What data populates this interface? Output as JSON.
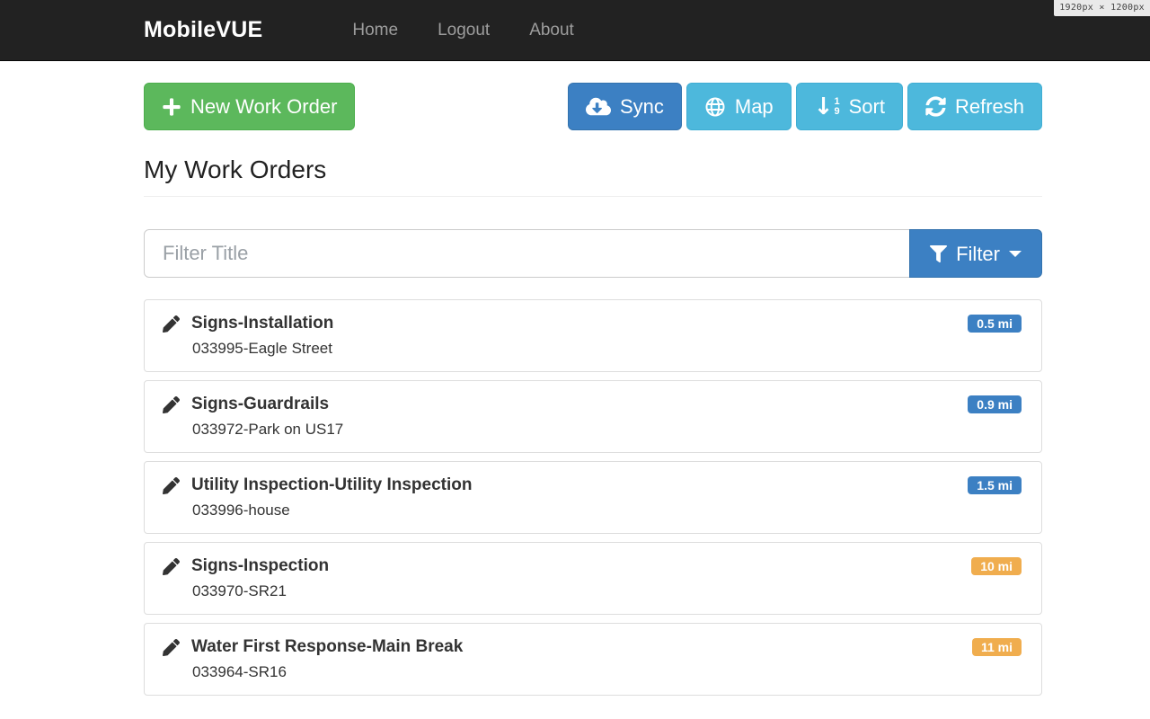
{
  "devtools_overlay": {
    "dimensions": "1920px × 1200px"
  },
  "navbar": {
    "brand": "MobileVUE",
    "links": [
      {
        "label": "Home"
      },
      {
        "label": "Logout"
      },
      {
        "label": "About"
      }
    ]
  },
  "toolbar": {
    "new_work_order_label": "New Work Order",
    "sync_label": "Sync",
    "map_label": "Map",
    "sort_label": "Sort",
    "sort_icon_top_digit": "1",
    "sort_icon_bottom_digit": "9",
    "refresh_label": "Refresh"
  },
  "page": {
    "title": "My Work Orders"
  },
  "filter": {
    "placeholder": "Filter Title",
    "value": "",
    "button_label": "Filter"
  },
  "work_orders": [
    {
      "title": "Signs-Installation",
      "subtitle": "033995-Eagle Street",
      "distance": "0.5 mi",
      "badge_color": "blue"
    },
    {
      "title": "Signs-Guardrails",
      "subtitle": "033972-Park on US17",
      "distance": "0.9 mi",
      "badge_color": "blue"
    },
    {
      "title": "Utility Inspection-Utility Inspection",
      "subtitle": "033996-house",
      "distance": "1.5 mi",
      "badge_color": "blue"
    },
    {
      "title": "Signs-Inspection",
      "subtitle": "033970-SR21",
      "distance": "10 mi",
      "badge_color": "orange"
    },
    {
      "title": "Water First Response-Main Break",
      "subtitle": "033964-SR16",
      "distance": "11 mi",
      "badge_color": "orange"
    }
  ],
  "colors": {
    "navbar_bg": "#222222",
    "success_green": "#5cb85c",
    "primary_blue": "#3c80c3",
    "info_blue": "#4db8dc",
    "warning_orange": "#f0ad4e"
  }
}
